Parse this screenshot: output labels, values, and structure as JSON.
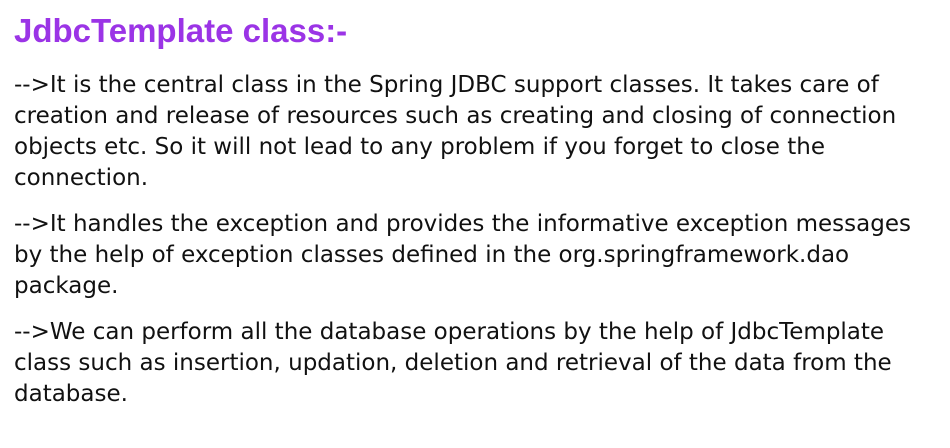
{
  "slide": {
    "title": "JdbcTemplate class:-",
    "paragraphs": [
      "-->It is the central class in the Spring JDBC support classes. It takes care of creation and release of resources such as creating and closing of connection objects etc. So it will not lead to any problem if you forget to close the connection.",
      "-->It handles the exception and provides the informative exception messages by the help of exception classes defined in the org.springframework.dao package.",
      "-->We can perform all the database operations by the help of JdbcTemplate class such as insertion, updation, deletion and retrieval of the data from the database."
    ]
  },
  "colors": {
    "title": "#9b34e6",
    "text": "#111111",
    "background": "#ffffff"
  }
}
